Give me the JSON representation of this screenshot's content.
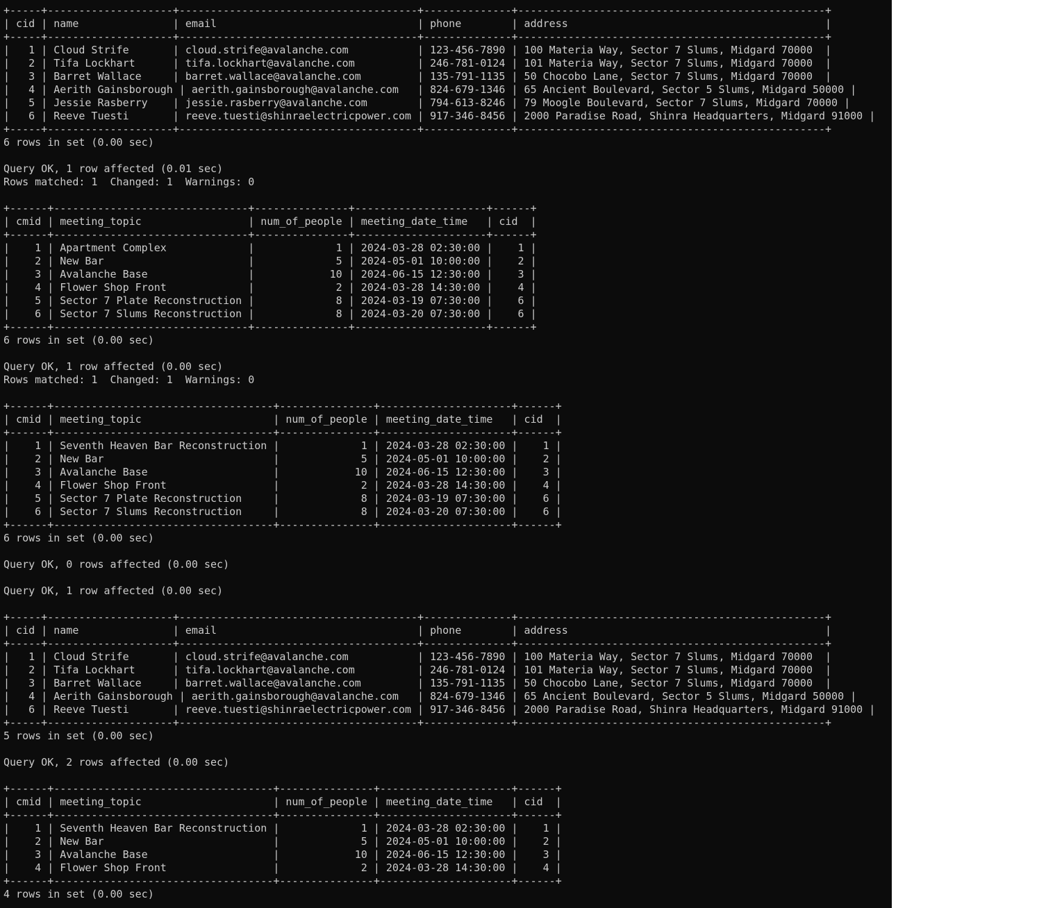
{
  "terminal": {
    "lines": [
      "+-----+--------------------+--------------------------------------+--------------+-------------------------------------------------+",
      "| cid | name               | email                                | phone        | address                                         |",
      "+-----+--------------------+--------------------------------------+--------------+-------------------------------------------------+",
      "|   1 | Cloud Strife       | cloud.strife@avalanche.com           | 123-456-7890 | 100 Materia Way, Sector 7 Slums, Midgard 70000  |",
      "|   2 | Tifa Lockhart      | tifa.lockhart@avalanche.com          | 246-781-0124 | 101 Materia Way, Sector 7 Slums, Midgard 70000  |",
      "|   3 | Barret Wallace     | barret.wallace@avalanche.com         | 135-791-1135 | 50 Chocobo Lane, Sector 7 Slums, Midgard 70000  |",
      "|   4 | Aerith Gainsborough | aerith.gainsborough@avalanche.com   | 824-679-1346 | 65 Ancient Boulevard, Sector 5 Slums, Midgard 50000 |",
      "|   5 | Jessie Rasberry    | jessie.rasberry@avalanche.com        | 794-613-8246 | 79 Moogle Boulevard, Sector 7 Slums, Midgard 70000 |",
      "|   6 | Reeve Tuesti       | reeve.tuesti@shinraelectricpower.com | 917-346-8456 | 2000 Paradise Road, Shinra Headquarters, Midgard 91000 |",
      "+-----+--------------------+--------------------------------------+--------------+-------------------------------------------------+",
      "6 rows in set (0.00 sec)",
      "",
      "Query OK, 1 row affected (0.01 sec)",
      "Rows matched: 1  Changed: 1  Warnings: 0",
      "",
      "+------+-------------------------------+---------------+---------------------+------+",
      "| cmid | meeting_topic                 | num_of_people | meeting_date_time   | cid  |",
      "+------+-------------------------------+---------------+---------------------+------+",
      "|    1 | Apartment Complex             |             1 | 2024-03-28 02:30:00 |    1 |",
      "|    2 | New Bar                       |             5 | 2024-05-01 10:00:00 |    2 |",
      "|    3 | Avalanche Base                |            10 | 2024-06-15 12:30:00 |    3 |",
      "|    4 | Flower Shop Front             |             2 | 2024-03-28 14:30:00 |    4 |",
      "|    5 | Sector 7 Plate Reconstruction |             8 | 2024-03-19 07:30:00 |    6 |",
      "|    6 | Sector 7 Slums Reconstruction |             8 | 2024-03-20 07:30:00 |    6 |",
      "+------+-------------------------------+---------------+---------------------+------+",
      "6 rows in set (0.00 sec)",
      "",
      "Query OK, 1 row affected (0.00 sec)",
      "Rows matched: 1  Changed: 1  Warnings: 0",
      "",
      "+------+-----------------------------------+---------------+---------------------+------+",
      "| cmid | meeting_topic                     | num_of_people | meeting_date_time   | cid  |",
      "+------+-----------------------------------+---------------+---------------------+------+",
      "|    1 | Seventh Heaven Bar Reconstruction |             1 | 2024-03-28 02:30:00 |    1 |",
      "|    2 | New Bar                           |             5 | 2024-05-01 10:00:00 |    2 |",
      "|    3 | Avalanche Base                    |            10 | 2024-06-15 12:30:00 |    3 |",
      "|    4 | Flower Shop Front                 |             2 | 2024-03-28 14:30:00 |    4 |",
      "|    5 | Sector 7 Plate Reconstruction     |             8 | 2024-03-19 07:30:00 |    6 |",
      "|    6 | Sector 7 Slums Reconstruction     |             8 | 2024-03-20 07:30:00 |    6 |",
      "+------+-----------------------------------+---------------+---------------------+------+",
      "6 rows in set (0.00 sec)",
      "",
      "Query OK, 0 rows affected (0.00 sec)",
      "",
      "Query OK, 1 row affected (0.00 sec)",
      "",
      "+-----+--------------------+--------------------------------------+--------------+-------------------------------------------------+",
      "| cid | name               | email                                | phone        | address                                         |",
      "+-----+--------------------+--------------------------------------+--------------+-------------------------------------------------+",
      "|   1 | Cloud Strife       | cloud.strife@avalanche.com           | 123-456-7890 | 100 Materia Way, Sector 7 Slums, Midgard 70000  |",
      "|   2 | Tifa Lockhart      | tifa.lockhart@avalanche.com          | 246-781-0124 | 101 Materia Way, Sector 7 Slums, Midgard 70000  |",
      "|   3 | Barret Wallace     | barret.wallace@avalanche.com         | 135-791-1135 | 50 Chocobo Lane, Sector 7 Slums, Midgard 70000  |",
      "|   4 | Aerith Gainsborough | aerith.gainsborough@avalanche.com   | 824-679-1346 | 65 Ancient Boulevard, Sector 5 Slums, Midgard 50000 |",
      "|   6 | Reeve Tuesti       | reeve.tuesti@shinraelectricpower.com | 917-346-8456 | 2000 Paradise Road, Shinra Headquarters, Midgard 91000 |",
      "+-----+--------------------+--------------------------------------+--------------+-------------------------------------------------+",
      "5 rows in set (0.00 sec)",
      "",
      "Query OK, 2 rows affected (0.00 sec)",
      "",
      "+------+-----------------------------------+---------------+---------------------+------+",
      "| cmid | meeting_topic                     | num_of_people | meeting_date_time   | cid  |",
      "+------+-----------------------------------+---------------+---------------------+------+",
      "|    1 | Seventh Heaven Bar Reconstruction |             1 | 2024-03-28 02:30:00 |    1 |",
      "|    2 | New Bar                           |             5 | 2024-05-01 10:00:00 |    2 |",
      "|    3 | Avalanche Base                    |            10 | 2024-06-15 12:30:00 |    3 |",
      "|    4 | Flower Shop Front                 |             2 | 2024-03-28 14:30:00 |    4 |",
      "+------+-----------------------------------+---------------+---------------------+------+",
      "4 rows in set (0.00 sec)"
    ]
  }
}
